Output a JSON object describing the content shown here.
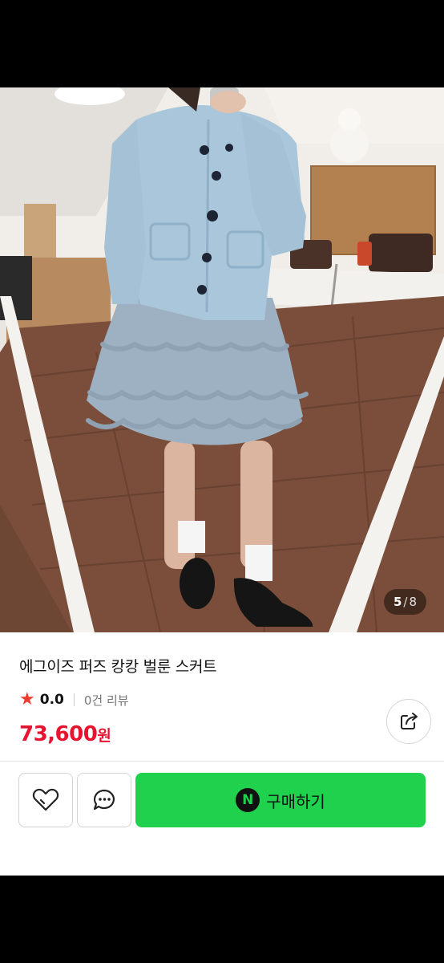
{
  "product": {
    "image_counter": {
      "current": "5",
      "separator": "/",
      "total": "8"
    },
    "title": "에그이즈 퍼즈 캉캉 벌룬 스커트",
    "rating": {
      "score": "0.0",
      "reviews": "0건 리뷰"
    },
    "price": {
      "amount": "73,600",
      "unit": "원"
    }
  },
  "actions": {
    "buy_label": "구매하기",
    "pay_badge": "N"
  },
  "colors": {
    "price": "#e8132f",
    "star": "#ef3b2d",
    "buy_button": "#1fd14c"
  },
  "icons": [
    "star-icon",
    "share-icon",
    "heart-icon",
    "chat-icon",
    "naver-pay-icon"
  ]
}
